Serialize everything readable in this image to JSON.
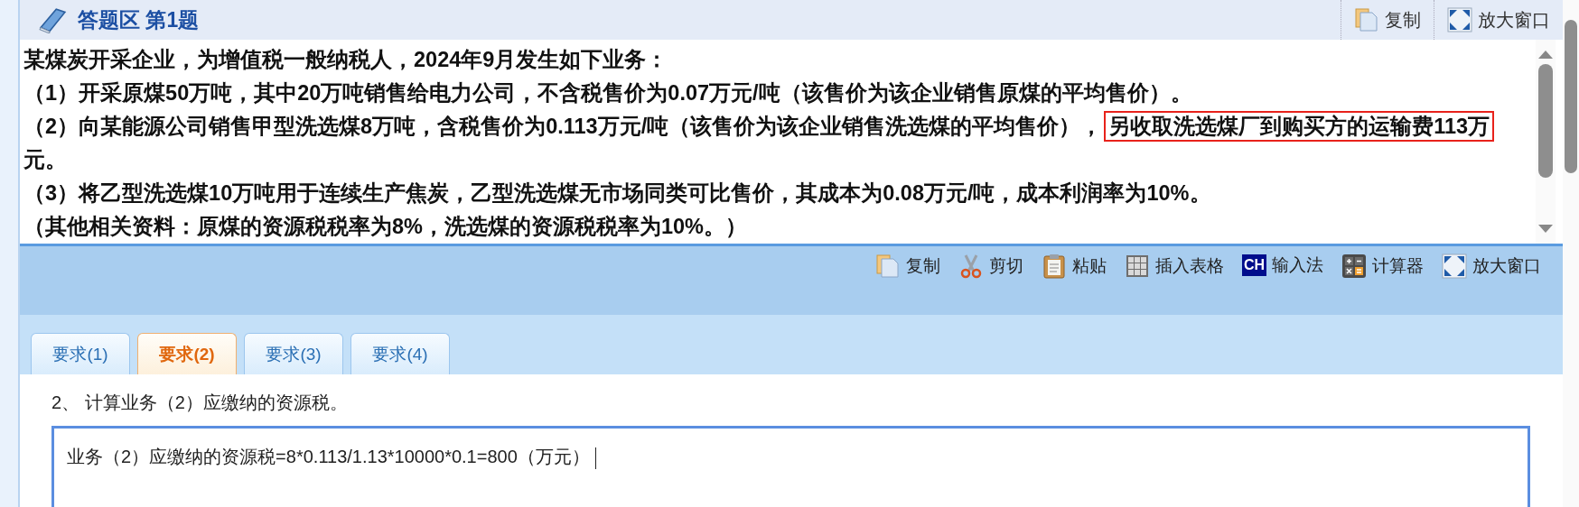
{
  "header": {
    "title": "答题区 第1题",
    "buttons": [
      {
        "kind": "copy",
        "label": "复制"
      },
      {
        "kind": "expand",
        "label": "放大窗口"
      }
    ]
  },
  "question": {
    "paragraphs": [
      [
        {
          "text": "某煤炭开采企业，为增值税一般纳税人，2024年9月发生如下业务：",
          "highlighted": false
        }
      ],
      [
        {
          "text": "（1）开采原煤50万吨，其中20万吨销售给电力公司，不含税售价为0.07万元/吨（该售价为该企业销售原煤的平均售价）。",
          "highlighted": false
        }
      ],
      [
        {
          "text": "（2）向某能源公司销售甲型洗选煤8万吨，含税售价为0.113万元/吨（该售价为该企业销售洗选煤的平均售价），",
          "highlighted": false
        },
        {
          "text": "另收取洗选煤厂到购买方的运输费113万",
          "highlighted": true
        },
        {
          "text": "元。",
          "highlighted": false
        }
      ],
      [
        {
          "text": "（3）将乙型洗选煤10万吨用于连续生产焦炭，乙型洗选煤无市场同类可比售价，其成本为0.08万元/吨，成本利润率为10%。",
          "highlighted": false
        }
      ],
      [
        {
          "text": "（其他相关资料：原煤的资源税税率为8%，洗选煤的资源税税率为10%。）",
          "highlighted": false
        }
      ]
    ]
  },
  "toolbar": [
    {
      "kind": "copy",
      "label": "复制"
    },
    {
      "kind": "cut",
      "label": "剪切"
    },
    {
      "kind": "paste",
      "label": "粘贴"
    },
    {
      "kind": "table",
      "label": "插入表格"
    },
    {
      "kind": "ime",
      "icon_text": "CH",
      "label": "输入法"
    },
    {
      "kind": "calc",
      "label": "计算器"
    },
    {
      "kind": "expand",
      "label": "放大窗口"
    }
  ],
  "tabs": [
    {
      "label": "要求(1)",
      "selected": false
    },
    {
      "label": "要求(2)",
      "selected": true
    },
    {
      "label": "要求(3)",
      "selected": false
    },
    {
      "label": "要求(4)",
      "selected": false
    }
  ],
  "prompt": "2、 计算业务（2）应缴纳的资源税。",
  "answer": {
    "value": "业务（2）应缴纳的资源税=8*0.113/1.13*10000*0.1=800（万元）",
    "caret": true
  }
}
